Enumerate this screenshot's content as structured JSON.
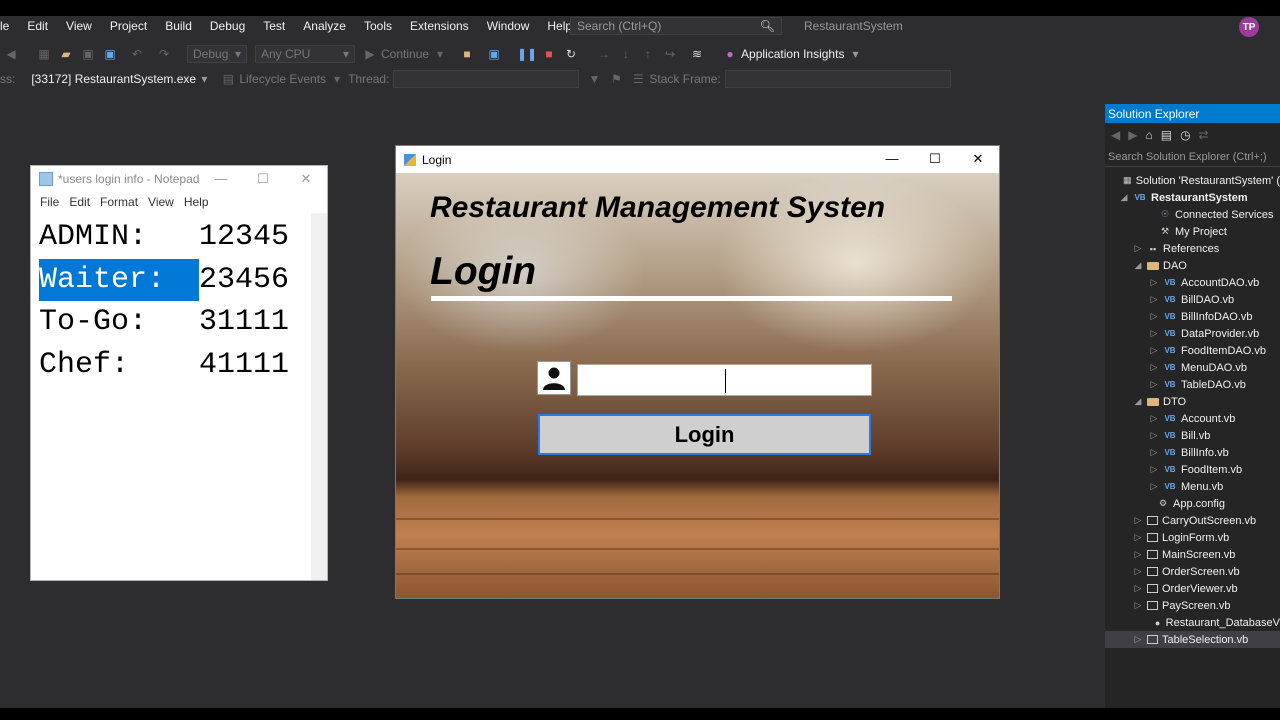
{
  "vs": {
    "menu": [
      "le",
      "Edit",
      "View",
      "Project",
      "Build",
      "Debug",
      "Test",
      "Analyze",
      "Tools",
      "Extensions",
      "Window",
      "Help"
    ],
    "search_placeholder": "Search (Ctrl+Q)",
    "title": "RestaurantSystem",
    "avatar": "TP",
    "toolbar": {
      "config": "Debug",
      "platform": "Any CPU",
      "continue": "Continue",
      "insights": "Application Insights"
    },
    "toolbar2": {
      "process_label": "ss:",
      "process": "[33172] RestaurantSystem.exe",
      "lifecycle": "Lifecycle Events",
      "thread_label": "Thread:",
      "stack_label": "Stack Frame:"
    }
  },
  "notepad": {
    "title": "*users login info - Notepad",
    "menu": [
      "File",
      "Edit",
      "Format",
      "View",
      "Help"
    ],
    "lines": [
      {
        "label": "ADMIN:",
        "code": "12345"
      },
      {
        "label": "Waiter:",
        "code": "23456"
      },
      {
        "label": "To-Go:",
        "code": "31111"
      },
      {
        "label": "Chef:",
        "code": "41111"
      }
    ]
  },
  "login": {
    "title": "Login",
    "heading": "Restaurant Management Systen",
    "subheading": "Login",
    "button": "Login",
    "input_value": ""
  },
  "solution": {
    "header": "Solution Explorer",
    "search": "Search Solution Explorer (Ctrl+;)",
    "items": [
      {
        "label": "Solution 'RestaurantSystem' (",
        "icon": "solution-icon"
      },
      {
        "label": "RestaurantSystem",
        "icon": "vb-project-icon"
      },
      {
        "label": "Connected Services",
        "icon": "connected-services-icon"
      },
      {
        "label": "My Project",
        "icon": "wrench-icon"
      },
      {
        "label": "References",
        "icon": "references-icon"
      },
      {
        "label": "DAO",
        "icon": "folder-icon"
      },
      {
        "label": "AccountDAO.vb",
        "icon": "vb-file-icon"
      },
      {
        "label": "BillDAO.vb",
        "icon": "vb-file-icon"
      },
      {
        "label": "BillInfoDAO.vb",
        "icon": "vb-file-icon"
      },
      {
        "label": "DataProvider.vb",
        "icon": "vb-file-icon"
      },
      {
        "label": "FoodItemDAO.vb",
        "icon": "vb-file-icon"
      },
      {
        "label": "MenuDAO.vb",
        "icon": "vb-file-icon"
      },
      {
        "label": "TableDAO.vb",
        "icon": "vb-file-icon"
      },
      {
        "label": "DTO",
        "icon": "folder-icon"
      },
      {
        "label": "Account.vb",
        "icon": "vb-file-icon"
      },
      {
        "label": "Bill.vb",
        "icon": "vb-file-icon"
      },
      {
        "label": "BillInfo.vb",
        "icon": "vb-file-icon"
      },
      {
        "label": "FoodItem.vb",
        "icon": "vb-file-icon"
      },
      {
        "label": "Menu.vb",
        "icon": "vb-file-icon"
      },
      {
        "label": "App.config",
        "icon": "config-icon"
      },
      {
        "label": "CarryOutScreen.vb",
        "icon": "form-icon"
      },
      {
        "label": "LoginForm.vb",
        "icon": "form-icon"
      },
      {
        "label": "MainScreen.vb",
        "icon": "form-icon"
      },
      {
        "label": "OrderScreen.vb",
        "icon": "form-icon"
      },
      {
        "label": "OrderViewer.vb",
        "icon": "form-icon"
      },
      {
        "label": "PayScreen.vb",
        "icon": "form-icon"
      },
      {
        "label": "Restaurant_DatabaseV",
        "icon": "database-icon"
      },
      {
        "label": "TableSelection.vb",
        "icon": "form-icon"
      }
    ]
  }
}
